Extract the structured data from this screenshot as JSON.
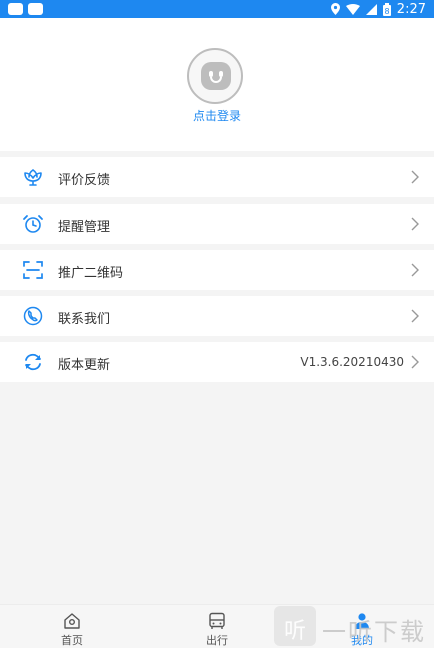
{
  "status_bar": {
    "time": "2:27",
    "battery_label": "8"
  },
  "profile": {
    "login_text": "点击登录"
  },
  "menu": [
    {
      "label": "评价反馈",
      "icon": "flower-icon"
    },
    {
      "label": "提醒管理",
      "icon": "alarm-clock-icon"
    },
    {
      "label": "推广二维码",
      "icon": "qr-scan-icon"
    },
    {
      "label": "联系我们",
      "icon": "phone-icon"
    },
    {
      "label": "版本更新",
      "icon": "refresh-icon",
      "value": "V1.3.6.20210430"
    }
  ],
  "bottom_nav": [
    {
      "label": "首页",
      "icon": "home-icon",
      "active": false
    },
    {
      "label": "出行",
      "icon": "bus-icon",
      "active": false
    },
    {
      "label": "我的",
      "icon": "user-icon",
      "active": true
    }
  ],
  "watermark": {
    "box_text": "听",
    "text": "一听下载"
  },
  "colors": {
    "accent": "#1e88f0",
    "background": "#f4f4f4",
    "text": "#333333"
  }
}
